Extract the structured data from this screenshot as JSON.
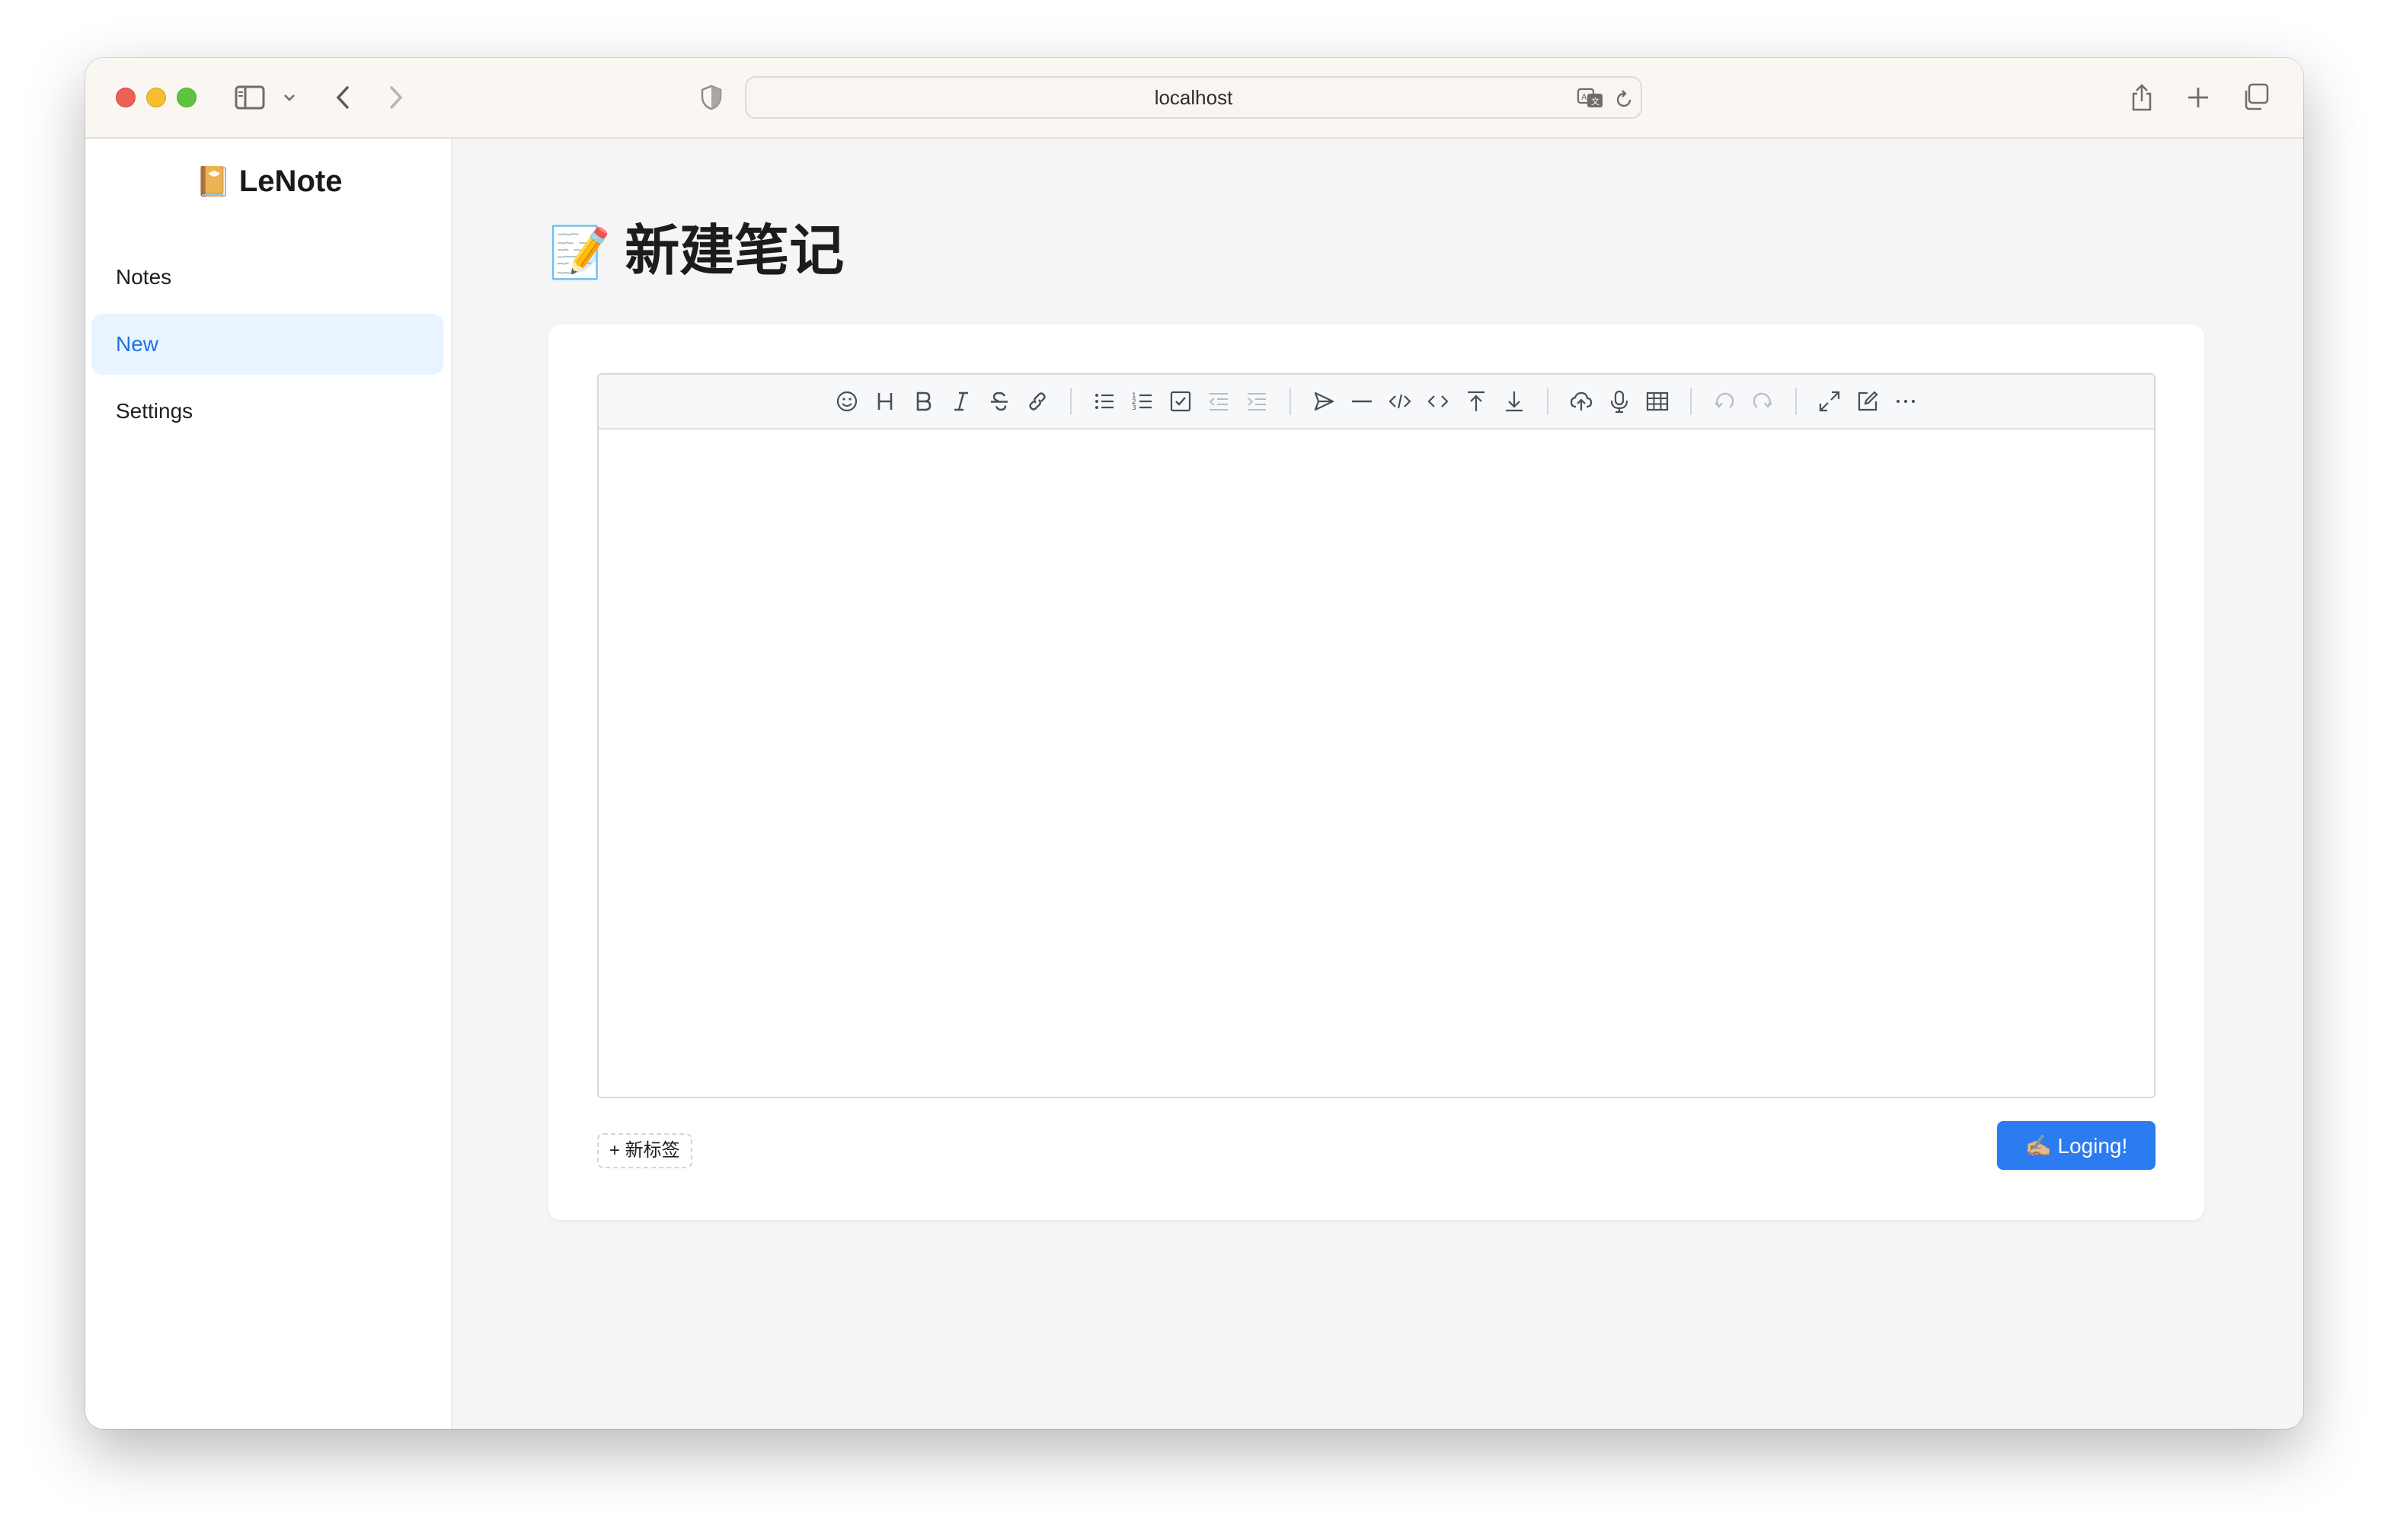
{
  "browser": {
    "url": "localhost"
  },
  "sidebar": {
    "brand_emoji": "📔",
    "brand": "LeNote",
    "items": [
      {
        "label": "Notes",
        "active": false
      },
      {
        "label": "New",
        "active": true
      },
      {
        "label": "Settings",
        "active": false
      }
    ]
  },
  "main": {
    "title_emoji": "📝",
    "title": "新建笔记",
    "editor": {
      "toolbar_groups": [
        [
          "emoji-icon",
          "heading-icon",
          "bold-icon",
          "italic-icon",
          "strikethrough-icon",
          "link-icon"
        ],
        [
          "bullet-list-icon",
          "ordered-list-icon",
          "checklist-icon",
          "outdent-icon",
          "indent-icon"
        ],
        [
          "quote-icon",
          "horizontal-rule-icon",
          "code-block-icon",
          "inline-code-icon",
          "insert-before-icon",
          "insert-after-icon"
        ],
        [
          "upload-icon",
          "record-icon",
          "table-icon"
        ],
        [
          "undo-icon",
          "redo-icon"
        ],
        [
          "fullscreen-icon",
          "edit-mode-icon",
          "more-icon"
        ]
      ],
      "content": ""
    },
    "new_tag_label": "+ 新标签",
    "submit_label": "✍🏼 Loging!"
  },
  "colors": {
    "accent": "#2b7bf1",
    "active_nav_bg": "#e8f4ff",
    "active_nav_text": "#1f73e0"
  }
}
